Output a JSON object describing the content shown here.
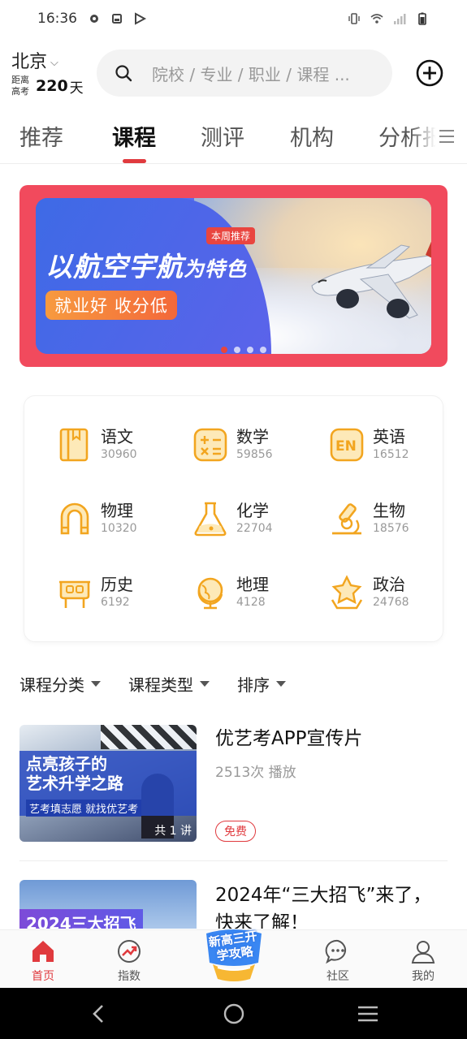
{
  "status_bar": {
    "time": "16:36"
  },
  "header": {
    "city": "北京",
    "countdown_prefix_line1": "距离",
    "countdown_prefix_line2": "高考",
    "countdown_days": "220",
    "countdown_unit": "天",
    "search_placeholder": "院校 / 专业 / 职业 / 课程 ..."
  },
  "tabs": [
    {
      "label": "推荐"
    },
    {
      "label": "课程"
    },
    {
      "label": "测评"
    },
    {
      "label": "机构"
    },
    {
      "label": "分析报"
    }
  ],
  "active_tab": "课程",
  "banner": {
    "badge": "本周推荐",
    "title_main": "以航空宇航",
    "title_tail": "为特色",
    "pill": "就业好 收分低",
    "page_count": 4,
    "active_page": 1
  },
  "subjects": [
    {
      "name": "语文",
      "count": "30960",
      "icon": "book-icon"
    },
    {
      "name": "数学",
      "count": "59856",
      "icon": "calculator-icon"
    },
    {
      "name": "英语",
      "count": "16512",
      "icon": "en-icon"
    },
    {
      "name": "物理",
      "count": "10320",
      "icon": "magnet-icon"
    },
    {
      "name": "化学",
      "count": "22704",
      "icon": "flask-icon"
    },
    {
      "name": "生物",
      "count": "18576",
      "icon": "microscope-icon"
    },
    {
      "name": "历史",
      "count": "6192",
      "icon": "tripod-icon"
    },
    {
      "name": "地理",
      "count": "4128",
      "icon": "globe-icon"
    },
    {
      "name": "政治",
      "count": "24768",
      "icon": "star-badge-icon"
    }
  ],
  "filters": [
    {
      "label": "课程分类"
    },
    {
      "label": "课程类型"
    },
    {
      "label": "排序"
    }
  ],
  "courses": [
    {
      "title": "优艺考APP宣传片",
      "plays": "2513次 播放",
      "badge": "免费",
      "thumb_line1": "点亮孩子的",
      "thumb_line2": "艺术升学之路",
      "thumb_sub": "艺考填志愿 就找优艺考",
      "lectures": "共 1 讲"
    },
    {
      "title": "2024年“三大招飞”来了，快来了解！",
      "thumb_tag": "2024三大招飞"
    }
  ],
  "bottom_nav": [
    {
      "label": "首页",
      "icon": "home-icon"
    },
    {
      "label": "指数",
      "icon": "trend-icon"
    },
    {
      "label": "新高三开学攻略",
      "icon": "promo-badge"
    },
    {
      "label": "社区",
      "icon": "chat-icon"
    },
    {
      "label": "我的",
      "icon": "user-icon"
    }
  ],
  "colors": {
    "accent": "#e03a3e",
    "icon_orange": "#f2a51f",
    "banner_bg": "#f14a5d"
  }
}
